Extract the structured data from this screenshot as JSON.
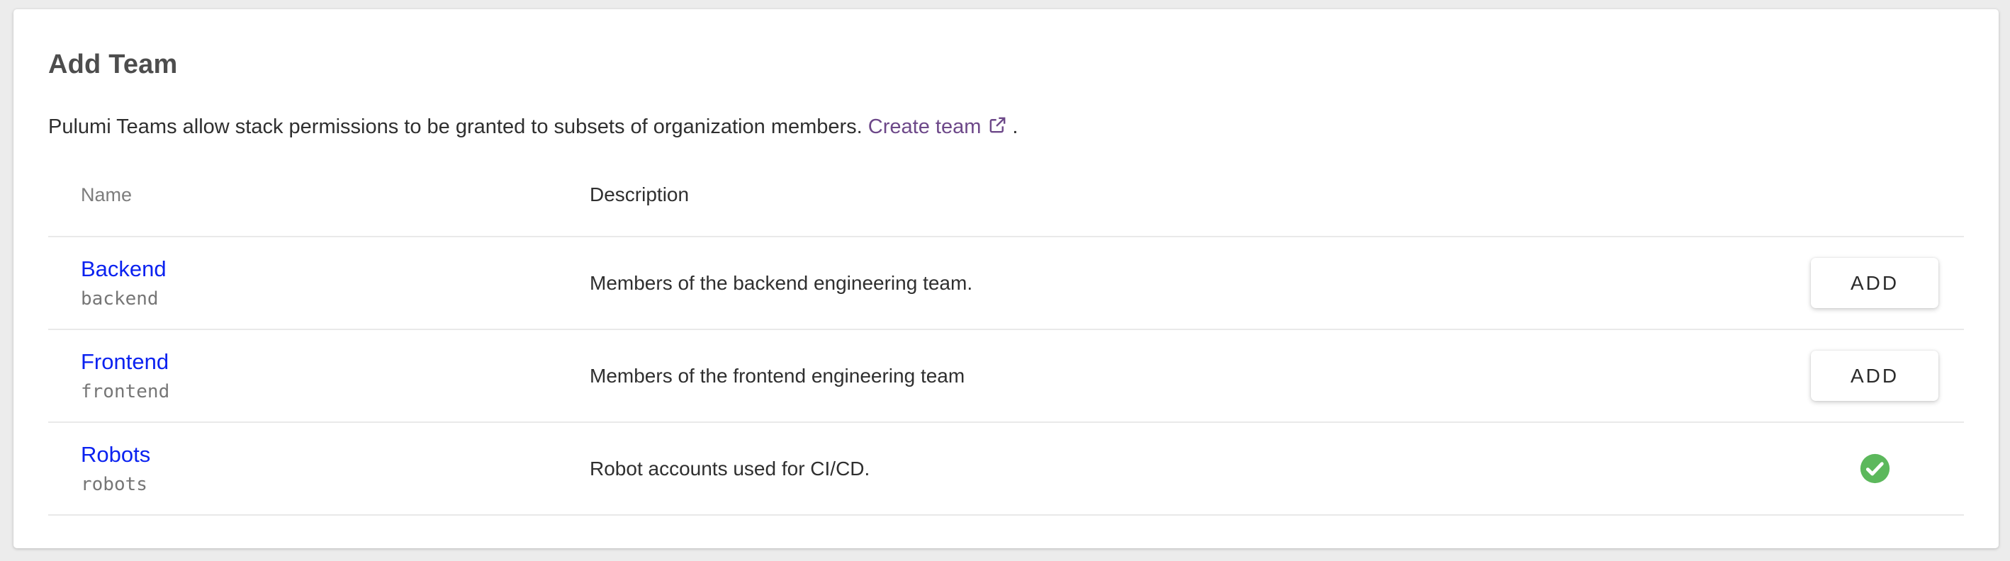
{
  "colors": {
    "page_background": "#ececec",
    "card_background": "#ffffff",
    "title_text": "#4d4d4d",
    "body_text": "#2f2f2f",
    "muted_header_text": "#7d7d7d",
    "team_link_blue": "#0b22f0",
    "create_link_purple": "#6d4889",
    "slug_gray": "#767676",
    "divider": "#e9e9e9",
    "success_green": "#5cb85c",
    "add_button_text": "#2b2b2b"
  },
  "header": {
    "title": "Add Team",
    "intro_text": "Pulumi Teams allow stack permissions to be granted to subsets of organization members.",
    "create_team_link_label": "Create team",
    "intro_suffix": "."
  },
  "table": {
    "columns": {
      "name": "Name",
      "description": "Description"
    },
    "rows": [
      {
        "name": "Backend",
        "slug": "backend",
        "description": "Members of the backend engineering team.",
        "action": "add-button",
        "action_label": "ADD"
      },
      {
        "name": "Frontend",
        "slug": "frontend",
        "description": "Members of the frontend engineering team",
        "action": "add-button",
        "action_label": "ADD"
      },
      {
        "name": "Robots",
        "slug": "robots",
        "description": "Robot accounts used for CI/CD.",
        "action": "added-check",
        "status_icon": "check-circle"
      }
    ]
  }
}
